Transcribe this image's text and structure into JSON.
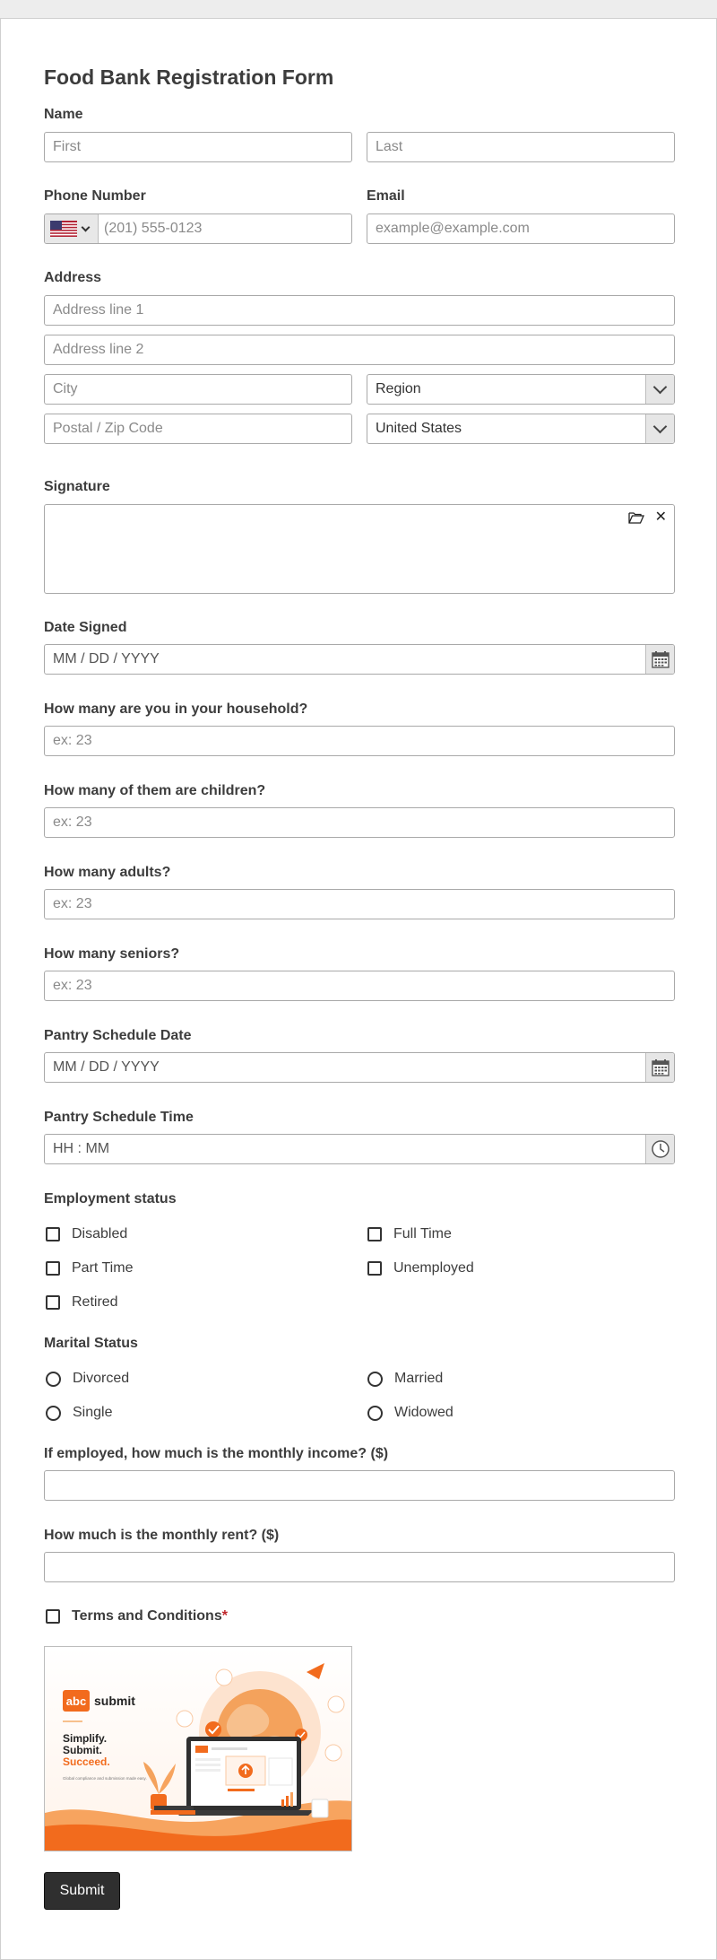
{
  "form": {
    "title": "Food Bank Registration Form",
    "name": {
      "label": "Name",
      "first_placeholder": "First",
      "last_placeholder": "Last"
    },
    "phone": {
      "label": "Phone Number",
      "placeholder": "(201) 555-0123",
      "country_flag": "us-flag-icon"
    },
    "email": {
      "label": "Email",
      "placeholder": "example@example.com"
    },
    "address": {
      "label": "Address",
      "line1_placeholder": "Address line 1",
      "line2_placeholder": "Address line 2",
      "city_placeholder": "City",
      "region_value": "Region",
      "postal_placeholder": "Postal / Zip Code",
      "country_value": "United States"
    },
    "signature": {
      "label": "Signature"
    },
    "date_signed": {
      "label": "Date Signed",
      "placeholder": "MM / DD / YYYY"
    },
    "household": {
      "label": "How many are you in your household?",
      "placeholder": "ex: 23"
    },
    "children": {
      "label": "How many of them are children?",
      "placeholder": "ex: 23"
    },
    "adults": {
      "label": "How many adults?",
      "placeholder": "ex: 23"
    },
    "seniors": {
      "label": "How many seniors?",
      "placeholder": "ex: 23"
    },
    "pantry_date": {
      "label": "Pantry Schedule Date",
      "placeholder": "MM / DD / YYYY"
    },
    "pantry_time": {
      "label": "Pantry Schedule Time",
      "placeholder": "HH : MM"
    },
    "employment": {
      "label": "Employment status",
      "options": [
        "Disabled",
        "Full Time",
        "Part Time",
        "Unemployed",
        "Retired"
      ]
    },
    "marital": {
      "label": "Marital Status",
      "options": [
        "Divorced",
        "Married",
        "Single",
        "Widowed"
      ]
    },
    "income": {
      "label": "If employed, how much is the monthly income? ($)"
    },
    "rent": {
      "label": "How much is the monthly rent? ($)"
    },
    "terms": {
      "label": "Terms and Conditions",
      "required_mark": "*"
    },
    "promo": {
      "logo_box": "abc",
      "logo_word": "submit",
      "line1": "Simplify.",
      "line2": "Submit.",
      "line3": "Succeed.",
      "small_text": "Global compliance and submission made easy."
    },
    "submit_label": "Submit"
  },
  "colors": {
    "accent": "#f26b1d",
    "button": "#2f2f2f",
    "required": "#c0262b"
  }
}
